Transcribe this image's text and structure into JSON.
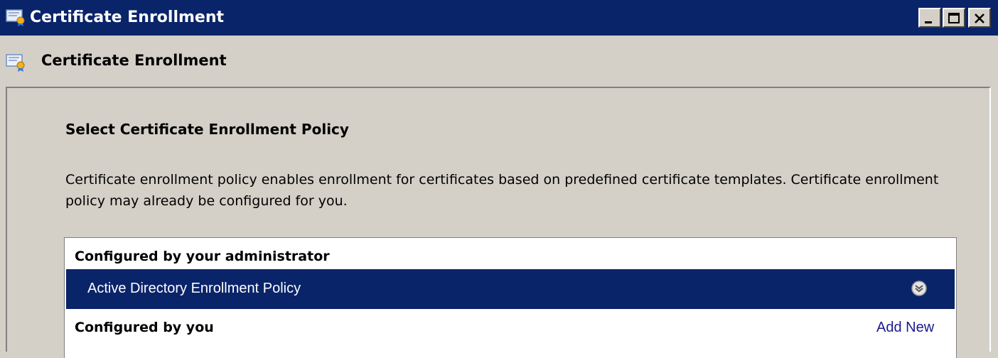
{
  "window": {
    "title": "Certificate Enrollment",
    "title_bar_color": "#0a246a",
    "controls": [
      "minimize-icon",
      "maximize-icon",
      "close-icon"
    ]
  },
  "header": {
    "title": "Certificate Enrollment",
    "icon": "certificate-icon"
  },
  "page": {
    "section_title": "Select Certificate Enrollment Policy",
    "description": "Certificate enrollment policy enables enrollment for certificates based on predefined certificate templates. Certificate enrollment policy may already be configured for you."
  },
  "policy_list": {
    "admin_group_label": "Configured by your administrator",
    "policies": [
      {
        "name": "Active Directory Enrollment Policy",
        "selected": true,
        "icon": "expand-details-icon"
      }
    ],
    "user_group_label": "Configured by you",
    "add_new_label": "Add New",
    "selection_color": "#0a246a",
    "link_color": "#1a1a8c"
  }
}
